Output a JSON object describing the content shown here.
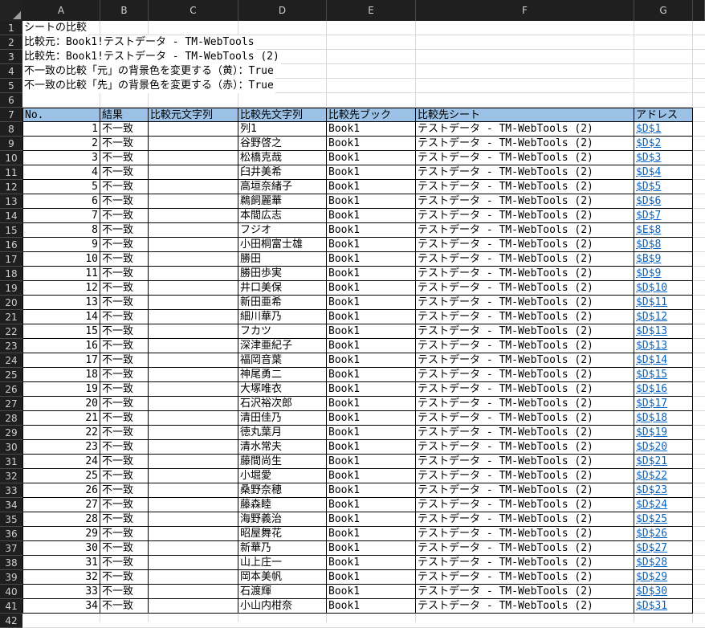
{
  "columns": [
    "A",
    "B",
    "C",
    "D",
    "E",
    "F",
    "G"
  ],
  "info_lines": [
    "シートの比較",
    "比較元：Book1!テストデータ - TM-WebTools",
    "比較先：Book1!テストデータ - TM-WebTools (2)",
    "不一致の比較「元」の背景色を変更する（黄）：True",
    "不一致の比較「先」の背景色を変更する（赤）：True"
  ],
  "table": {
    "headers": [
      "No.",
      "結果",
      "比較元文字列",
      "比較先文字列",
      "比較先ブック",
      "比較先シート",
      "アドレス"
    ],
    "rows": [
      [
        "1",
        "不一致",
        "",
        "列1",
        "Book1",
        "テストデータ - TM-WebTools (2)",
        "$D$1"
      ],
      [
        "2",
        "不一致",
        "",
        "谷野啓之",
        "Book1",
        "テストデータ - TM-WebTools (2)",
        "$D$2"
      ],
      [
        "3",
        "不一致",
        "",
        "松橋克哉",
        "Book1",
        "テストデータ - TM-WebTools (2)",
        "$D$3"
      ],
      [
        "4",
        "不一致",
        "",
        "臼井美希",
        "Book1",
        "テストデータ - TM-WebTools (2)",
        "$D$4"
      ],
      [
        "5",
        "不一致",
        "",
        "高垣奈緒子",
        "Book1",
        "テストデータ - TM-WebTools (2)",
        "$D$5"
      ],
      [
        "6",
        "不一致",
        "",
        "鵜飼麗華",
        "Book1",
        "テストデータ - TM-WebTools (2)",
        "$D$6"
      ],
      [
        "7",
        "不一致",
        "",
        "本間広志",
        "Book1",
        "テストデータ - TM-WebTools (2)",
        "$D$7"
      ],
      [
        "8",
        "不一致",
        "",
        "フジオ",
        "Book1",
        "テストデータ - TM-WebTools (2)",
        "$E$8"
      ],
      [
        "9",
        "不一致",
        "",
        "小田桐富士雄",
        "Book1",
        "テストデータ - TM-WebTools (2)",
        "$D$8"
      ],
      [
        "10",
        "不一致",
        "",
        "勝田",
        "Book1",
        "テストデータ - TM-WebTools (2)",
        "$B$9"
      ],
      [
        "11",
        "不一致",
        "",
        "勝田歩実",
        "Book1",
        "テストデータ - TM-WebTools (2)",
        "$D$9"
      ],
      [
        "12",
        "不一致",
        "",
        "井口美保",
        "Book1",
        "テストデータ - TM-WebTools (2)",
        "$D$10"
      ],
      [
        "13",
        "不一致",
        "",
        "新田亜希",
        "Book1",
        "テストデータ - TM-WebTools (2)",
        "$D$11"
      ],
      [
        "14",
        "不一致",
        "",
        "細川華乃",
        "Book1",
        "テストデータ - TM-WebTools (2)",
        "$D$12"
      ],
      [
        "15",
        "不一致",
        "",
        "フカツ",
        "Book1",
        "テストデータ - TM-WebTools (2)",
        "$D$13"
      ],
      [
        "16",
        "不一致",
        "",
        "深津亜紀子",
        "Book1",
        "テストデータ - TM-WebTools (2)",
        "$D$13"
      ],
      [
        "17",
        "不一致",
        "",
        "福岡音葉",
        "Book1",
        "テストデータ - TM-WebTools (2)",
        "$D$14"
      ],
      [
        "18",
        "不一致",
        "",
        "神尾勇二",
        "Book1",
        "テストデータ - TM-WebTools (2)",
        "$D$15"
      ],
      [
        "19",
        "不一致",
        "",
        "大塚唯衣",
        "Book1",
        "テストデータ - TM-WebTools (2)",
        "$D$16"
      ],
      [
        "20",
        "不一致",
        "",
        "石沢裕次郎",
        "Book1",
        "テストデータ - TM-WebTools (2)",
        "$D$17"
      ],
      [
        "21",
        "不一致",
        "",
        "清田佳乃",
        "Book1",
        "テストデータ - TM-WebTools (2)",
        "$D$18"
      ],
      [
        "22",
        "不一致",
        "",
        "徳丸葉月",
        "Book1",
        "テストデータ - TM-WebTools (2)",
        "$D$19"
      ],
      [
        "23",
        "不一致",
        "",
        "清水常夫",
        "Book1",
        "テストデータ - TM-WebTools (2)",
        "$D$20"
      ],
      [
        "24",
        "不一致",
        "",
        "藤間尚生",
        "Book1",
        "テストデータ - TM-WebTools (2)",
        "$D$21"
      ],
      [
        "25",
        "不一致",
        "",
        "小堀愛",
        "Book1",
        "テストデータ - TM-WebTools (2)",
        "$D$22"
      ],
      [
        "26",
        "不一致",
        "",
        "桑野奈穂",
        "Book1",
        "テストデータ - TM-WebTools (2)",
        "$D$23"
      ],
      [
        "27",
        "不一致",
        "",
        "藤森睦",
        "Book1",
        "テストデータ - TM-WebTools (2)",
        "$D$24"
      ],
      [
        "28",
        "不一致",
        "",
        "海野義治",
        "Book1",
        "テストデータ - TM-WebTools (2)",
        "$D$25"
      ],
      [
        "29",
        "不一致",
        "",
        "昭屋舞花",
        "Book1",
        "テストデータ - TM-WebTools (2)",
        "$D$26"
      ],
      [
        "30",
        "不一致",
        "",
        "新華乃",
        "Book1",
        "テストデータ - TM-WebTools (2)",
        "$D$27"
      ],
      [
        "31",
        "不一致",
        "",
        "山上庄一",
        "Book1",
        "テストデータ - TM-WebTools (2)",
        "$D$28"
      ],
      [
        "32",
        "不一致",
        "",
        "岡本美帆",
        "Book1",
        "テストデータ - TM-WebTools (2)",
        "$D$29"
      ],
      [
        "33",
        "不一致",
        "",
        "石渡輝",
        "Book1",
        "テストデータ - TM-WebTools (2)",
        "$D$30"
      ],
      [
        "34",
        "不一致",
        "",
        "小山内柑奈",
        "Book1",
        "テストデータ - TM-WebTools (2)",
        "$D$31"
      ]
    ]
  },
  "colors": {
    "header_fill": "#9bc2e6",
    "link": "#0563c1",
    "chrome": "#1f1f1f",
    "gridline": "#d9d9d9"
  }
}
